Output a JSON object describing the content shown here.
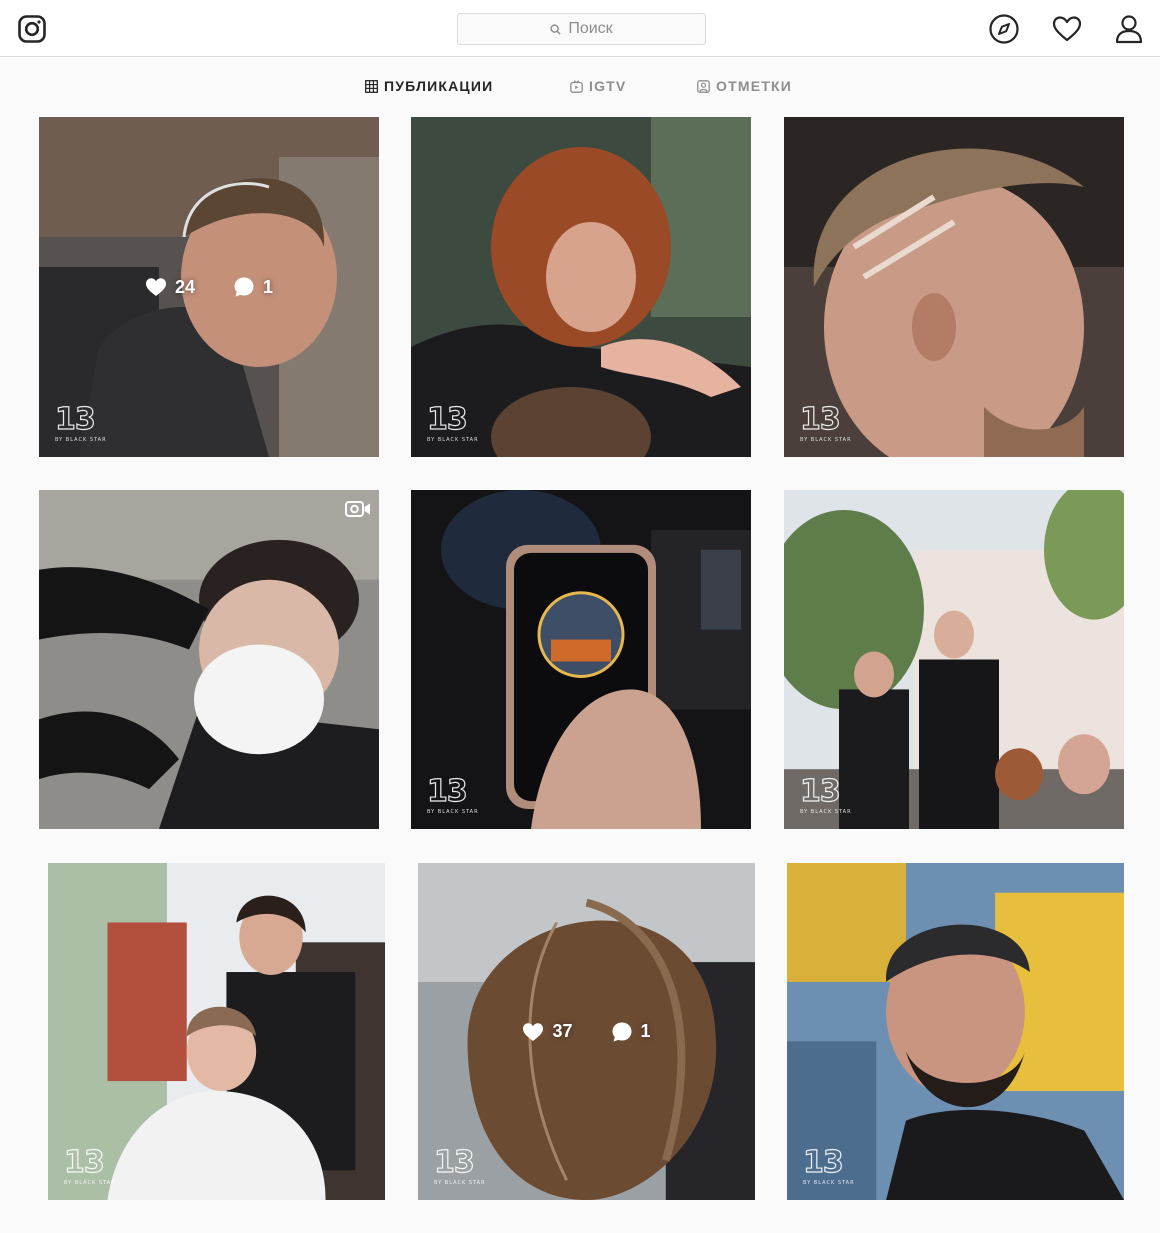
{
  "header": {
    "search_placeholder": "Поиск",
    "icons": [
      "instagram-logo-icon",
      "search-icon",
      "compass-icon",
      "heart-icon",
      "profile-icon"
    ]
  },
  "tabs": [
    {
      "label": "ПУБЛИКАЦИИ",
      "icon": "grid-icon",
      "active": true
    },
    {
      "label": "IGTV",
      "icon": "igtv-icon",
      "active": false
    },
    {
      "label": "ОТМЕТКИ",
      "icon": "tagged-icon",
      "active": false
    }
  ],
  "brand": {
    "mark": "13",
    "sub": "BY BLACK STAR"
  },
  "posts": [
    {
      "likes": "24",
      "comments": "1",
      "overlay": true
    },
    {
      "overlay": false
    },
    {
      "overlay": false
    },
    {
      "overlay": false,
      "video": true
    },
    {
      "overlay": false
    },
    {
      "overlay": false
    },
    {
      "overlay": false
    },
    {
      "likes": "37",
      "comments": "1",
      "overlay": true
    },
    {
      "overlay": false
    }
  ],
  "colors": {
    "border": "#dbdbdb",
    "text": "#262626",
    "muted": "#8e8e8e",
    "bg": "#fafafa"
  }
}
